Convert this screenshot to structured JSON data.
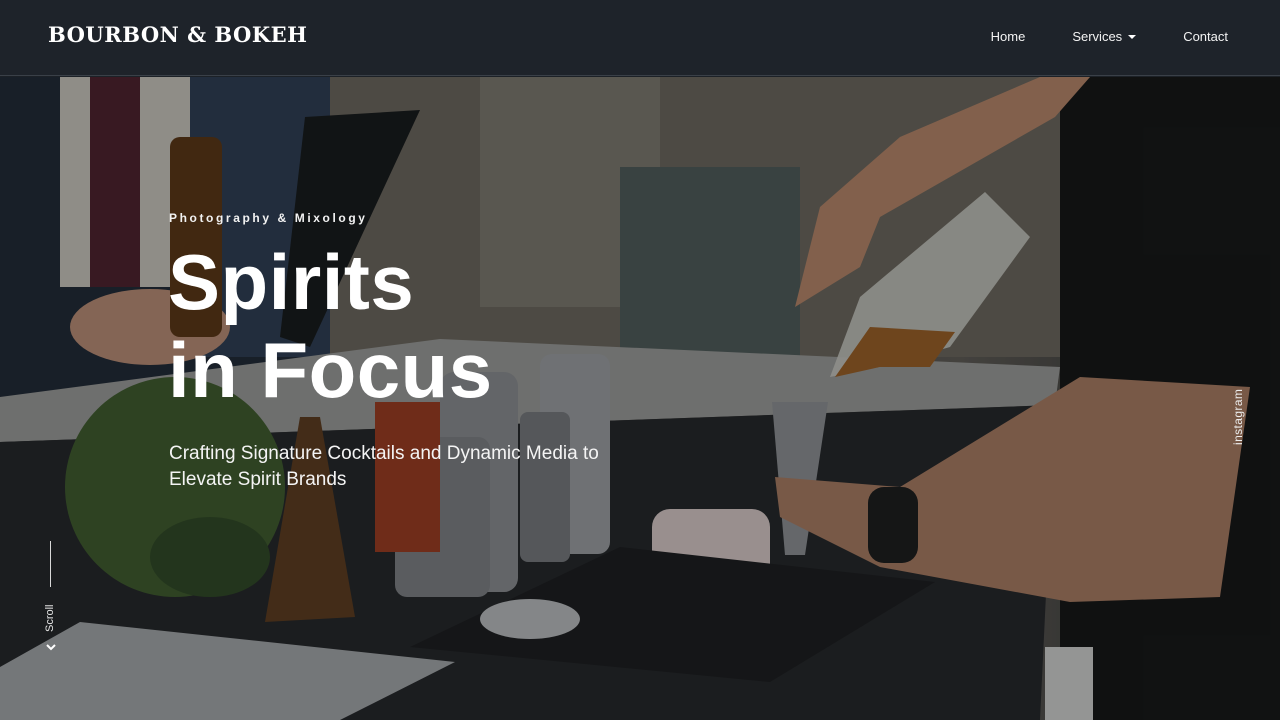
{
  "brand": {
    "logo_text": "BOURBON & BOKEH"
  },
  "nav": {
    "items": [
      {
        "label": "Home"
      },
      {
        "label": "Services"
      },
      {
        "label": "Contact"
      }
    ]
  },
  "hero": {
    "eyebrow": "Photography & Mixology",
    "headline_line1": "Spirits",
    "headline_line2": "in Focus",
    "subhead": "Crafting Signature Cocktails and Dynamic Media to Elevate Spirit Brands"
  },
  "sidebar": {
    "scroll_label": "Scroll",
    "social_label": "instagram"
  },
  "colors": {
    "navbar_bg": "#1e232a",
    "text": "#ffffff"
  }
}
